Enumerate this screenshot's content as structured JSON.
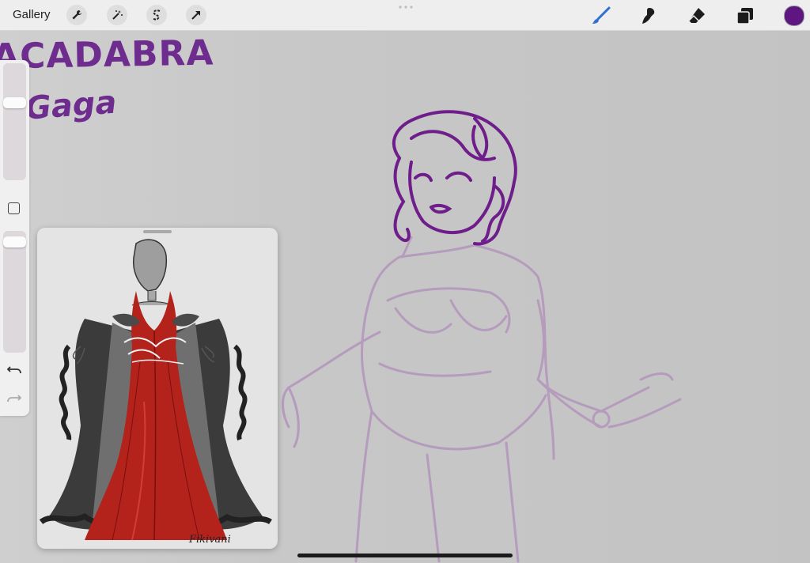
{
  "topbar": {
    "gallery_label": "Gallery",
    "actions": [
      "wrench-icon",
      "magic-wand-icon",
      "selection-s-icon",
      "transform-arrow-icon"
    ],
    "tools": [
      "brush-icon",
      "smudge-icon",
      "eraser-icon",
      "layers-icon"
    ],
    "active_tool": "brush-icon",
    "current_color": "#5e1680",
    "accent": "#2f6fd6"
  },
  "canvas": {
    "title_text": "ACADABRA",
    "subtitle_text": "y Gaga",
    "ink_color": "#6e2d8e",
    "sketch_color": "#b08fb8"
  },
  "sidebar": {
    "brush_size_level": 0.68,
    "opacity_level": 0.95
  },
  "reference": {
    "signature": "Fikivani"
  }
}
